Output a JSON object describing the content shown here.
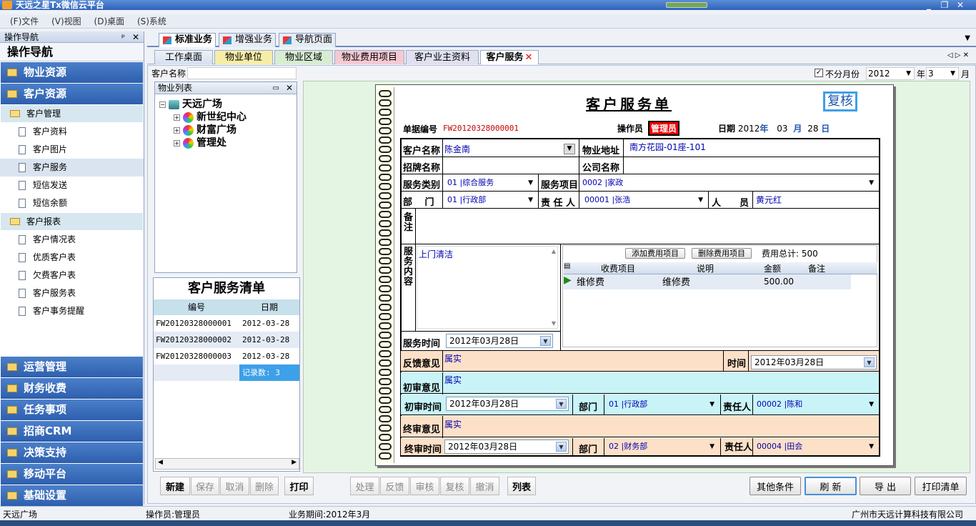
{
  "app": {
    "title": "天远之星Tx微信云平台"
  },
  "menu": [
    "(F)文件",
    "(V)视图",
    "(D)桌面",
    "(S)系统"
  ],
  "nav": {
    "header": "操作导航",
    "pin": "ᵖ",
    "close": "✕",
    "title": "操作导航",
    "groups_top": [
      "物业资源",
      "客户资源"
    ],
    "sub1": "客户管理",
    "items1": [
      "客户资料",
      "客户图片",
      "客户服务",
      "短信发送",
      "短信余额"
    ],
    "sub2": "客户报表",
    "items2": [
      "客户情况表",
      "优质客户表",
      "欠费客户表",
      "客户服务表",
      "客户事务提醒"
    ],
    "groups_bottom": [
      "运营管理",
      "财务收费",
      "任务事项",
      "招商CRM",
      "决策支持",
      "移动平台",
      "基础设置"
    ]
  },
  "tabs1": [
    "标准业务",
    "增强业务",
    "导航页面"
  ],
  "tabs2": [
    "工作桌面",
    "物业单位",
    "物业区域",
    "物业费用项目",
    "客户业主资料",
    "客户服务"
  ],
  "tab_close": "✕",
  "filter": {
    "cust_label": "客户名称",
    "nomonth_label": "不分月份",
    "year": "2012",
    "year_unit": "年",
    "month": "3",
    "month_unit": "月"
  },
  "tree": {
    "title": "物业列表",
    "root": "天远广场",
    "children": [
      "新世纪中心",
      "财富广场",
      "管理处"
    ]
  },
  "list": {
    "title": "客户服务清单",
    "col_no": "编号",
    "col_date": "日期",
    "rows": [
      {
        "no": "FW20120328000001",
        "date": "2012-03-28"
      },
      {
        "no": "FW20120328000002",
        "date": "2012-03-28"
      },
      {
        "no": "FW20120328000003",
        "date": "2012-03-28"
      }
    ],
    "count": "记录数: 3"
  },
  "form": {
    "title": "客户服务单",
    "stamp": "复核",
    "no_label": "单据编号",
    "no": "FW20120328000001",
    "op_label": "操作员",
    "op": "管理员",
    "date_label": "日期",
    "date_y": "2012",
    "y": "年",
    "date_m": "03",
    "m": "月",
    "date_d": "28",
    "d": "日",
    "cust_label": "客户名称",
    "cust": "陈金南",
    "addr_label": "物业地址",
    "addr": "南方花园-01座-101",
    "brand_label": "招牌名称",
    "company_label": "公司名称",
    "svc_type_label": "服务类别",
    "svc_type": "01       |综合服务",
    "svc_item_label": "服务项目",
    "svc_item": "0002       |家政",
    "dept_label": "部　 门",
    "dept": "01       |行政部",
    "resp_label": "责 任 人",
    "resp": "00001       |张浩",
    "staff_label": "人　　员",
    "staff": "黄元红",
    "remark_label": "备注",
    "content_label": "服务内容",
    "content": "上门清洁",
    "add_fee": "添加费用项目",
    "del_fee": "删除费用项目",
    "fee_total_label": "费用总计:",
    "fee_total": "500",
    "fee_cols": [
      "收费项目",
      "说明",
      "金额",
      "备注"
    ],
    "fee_row": {
      "item": "维修费",
      "desc": "维修费",
      "amount": "500.00"
    },
    "svc_time_label": "服务时间",
    "svc_time": "2012年03月28日",
    "feedback_label": "反馈意见",
    "feedback": "属实",
    "time_label": "时间",
    "fb_time": "2012年03月28日",
    "first_label": "初审意见",
    "first": "属实",
    "first_time_label": "初审时间",
    "first_time": "2012年03月28日",
    "first_dept_label": "部门",
    "first_dept": "01       |行政部",
    "first_resp_label": "责任人",
    "first_resp": "00002       |陈和",
    "final_label": "终审意见",
    "final": "属实",
    "final_time_label": "终审时间",
    "final_time": "2012年03月28日",
    "final_dept_label": "部门",
    "final_dept": "02       |财务部",
    "final_resp_label": "责任人",
    "final_resp": "00004       |田会"
  },
  "buttons": {
    "new": "新建",
    "save": "保存",
    "cancel": "取消",
    "delete": "删除",
    "print": "打印",
    "process": "处理",
    "feedback": "反馈",
    "review": "审核",
    "recheck": "复核",
    "void": "撤消",
    "list": "列表",
    "other": "其他条件",
    "refresh": "刷 新",
    "export": "导 出",
    "printlist": "打印清单"
  },
  "status": {
    "company": "天远广场",
    "operator": "操作员:管理员",
    "period": "业务期间:2012年3月",
    "vendor": "广州市天远计算科技有限公司"
  },
  "colors": {
    "nav_blue": "#2d5fae",
    "feedback_bg": "#fde0c8",
    "first_bg": "#c8f4f8",
    "form_bg": "#e5f5e3"
  }
}
